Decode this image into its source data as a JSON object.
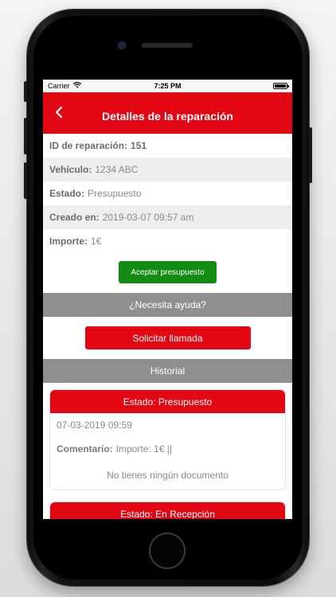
{
  "status_bar": {
    "carrier": "Carrier",
    "time": "7:25 PM"
  },
  "nav": {
    "title": "Detalles de la reparación",
    "back_icon": "chevron-left-icon"
  },
  "details": {
    "repair_id_label": "ID de reparación:",
    "repair_id_value": "151",
    "vehicle_label": "Vehículo:",
    "vehicle_value": "1234 ABC",
    "status_label": "Estado:",
    "status_value": "Presupuesto",
    "created_label": "Creado en:",
    "created_value": "2019-03-07 09:57 am",
    "amount_label": "Importe:",
    "amount_value": "1€"
  },
  "actions": {
    "accept_label": "Aceptar presupuesto"
  },
  "help": {
    "header": "¿Necesita ayuda?",
    "call_label": "Solicitar llamada"
  },
  "history": {
    "header": "Historial",
    "entries": [
      {
        "status": "Estado: Presupuesto",
        "date": "07-03-2019 09:59",
        "comment_label": "Comentario:",
        "comment_value": "Importe: 1€ ||",
        "documents": "No tienes ningún documento"
      },
      {
        "status": "Estado: En Recepción"
      }
    ]
  },
  "colors": {
    "primary_red": "#e30613",
    "accept_green": "#148c14",
    "section_grey": "#8f8f8f"
  }
}
